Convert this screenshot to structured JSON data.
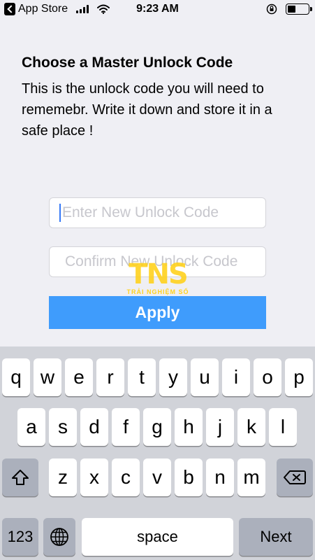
{
  "status_bar": {
    "back_app": "App Store",
    "time": "9:23 AM",
    "battery_level": 0.4
  },
  "header": {
    "title": "Choose a Master Unlock Code",
    "description": "This is the unlock code you will need to rememebr. Write it down and store it in a safe place !"
  },
  "form": {
    "new_code_placeholder": "Enter New Unlock Code",
    "confirm_code_placeholder": "Confirm New Unlock Code",
    "apply_label": "Apply"
  },
  "watermark": {
    "logo": "TNS",
    "subtitle": "TRẢI NGHIỆM SỐ"
  },
  "keyboard": {
    "row1": [
      "q",
      "w",
      "e",
      "r",
      "t",
      "y",
      "u",
      "i",
      "o",
      "p"
    ],
    "row2": [
      "a",
      "s",
      "d",
      "f",
      "g",
      "h",
      "j",
      "k",
      "l"
    ],
    "row3": [
      "z",
      "x",
      "c",
      "v",
      "b",
      "n",
      "m"
    ],
    "numbers_label": "123",
    "space_label": "space",
    "next_label": "Next",
    "shift_icon": "shift-icon",
    "delete_icon": "delete-icon",
    "globe_icon": "globe-icon"
  }
}
